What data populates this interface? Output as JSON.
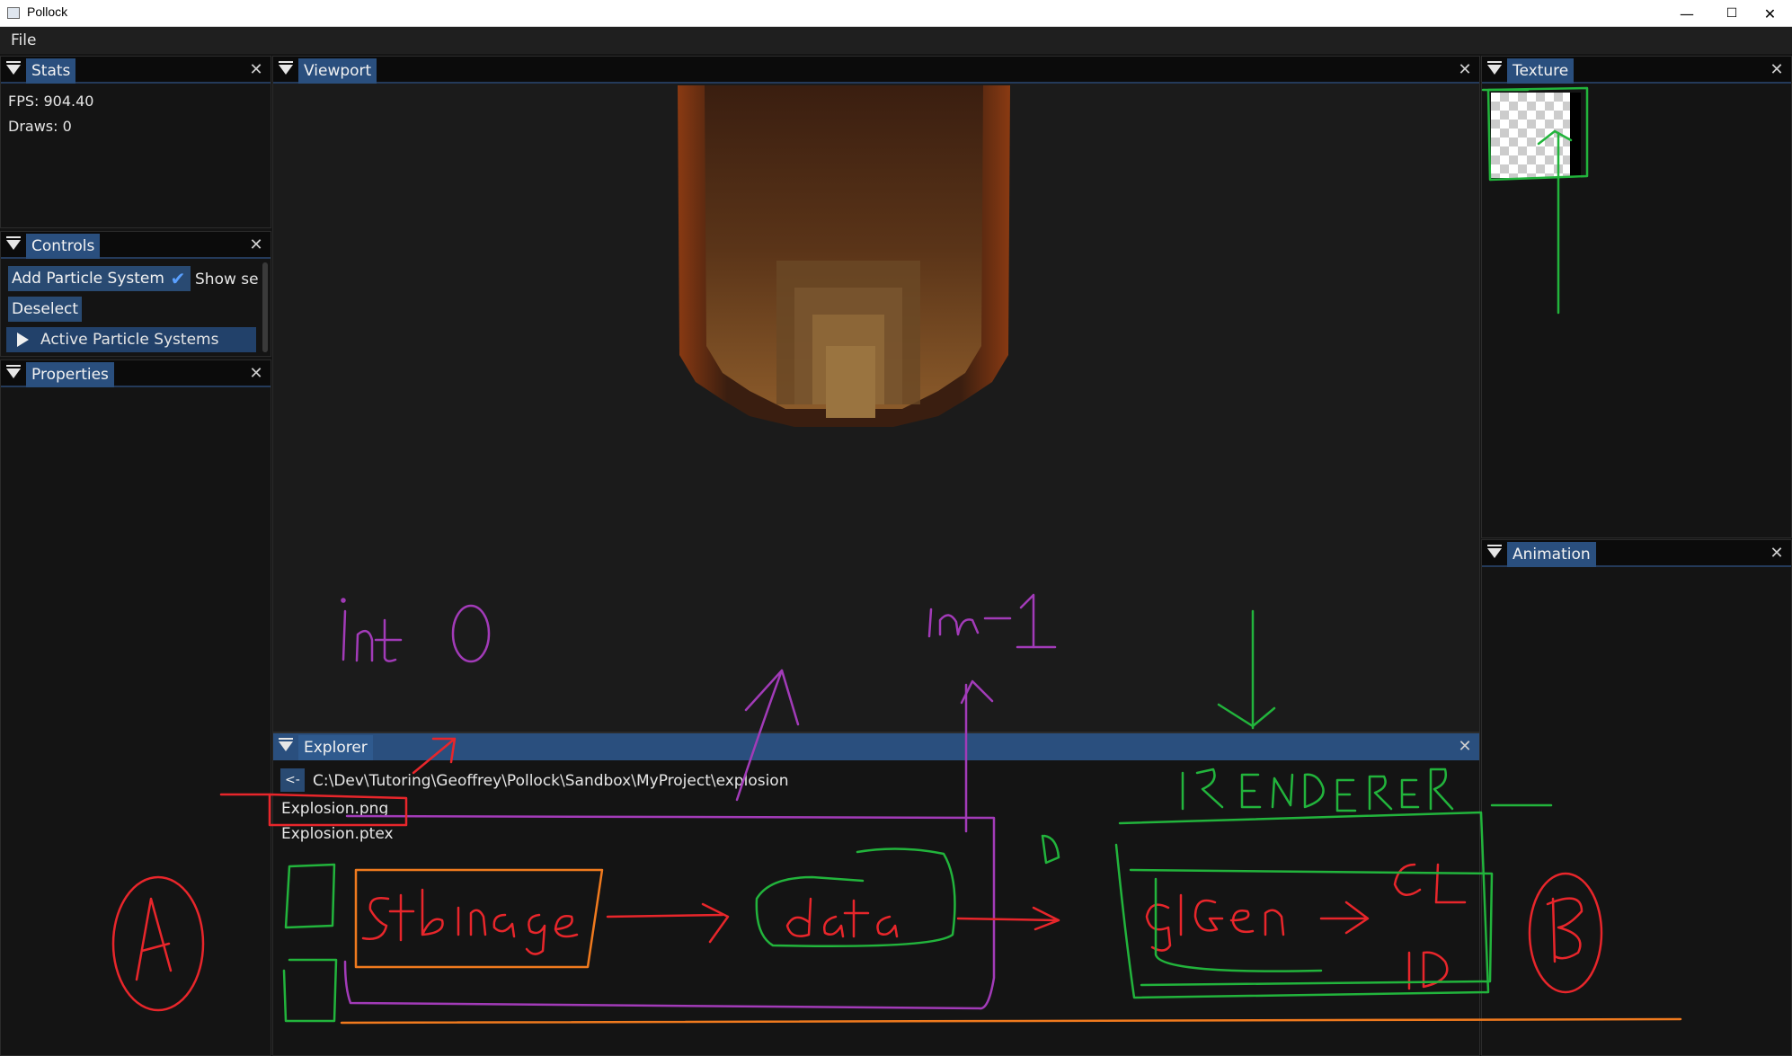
{
  "window": {
    "title": "Pollock"
  },
  "window_controls": {
    "minimize": "—",
    "maximize": "☐",
    "close": "✕"
  },
  "menu": {
    "file": "File"
  },
  "panels": {
    "stats": {
      "tab": "Stats",
      "fps": "FPS: 904.40",
      "draws": "Draws: 0"
    },
    "controls": {
      "tab": "Controls",
      "add_particle_system": "Add Particle System",
      "show_label": "Show se",
      "show_checked": true,
      "deselect": "Deselect",
      "active_particle_systems": "Active Particle Systems"
    },
    "properties": {
      "tab": "Properties"
    },
    "viewport": {
      "tab": "Viewport"
    },
    "texture": {
      "tab": "Texture"
    },
    "animation": {
      "tab": "Animation"
    },
    "explorer": {
      "tab": "Explorer",
      "back_button": "<-",
      "path": "C:\\Dev\\Tutoring\\Geoffrey\\Pollock\\Sandbox\\MyProject\\explosion",
      "files": [
        "Explosion.png",
        "Explosion.ptex"
      ]
    }
  },
  "icons": {
    "panel_menu": "triangle-down-icon",
    "close": "close-icon",
    "expand": "play-triangle-icon",
    "checkbox": "checkmark-icon",
    "app": "app-icon"
  },
  "colors": {
    "accent": "#2a4f7e",
    "panel_bg": "#141414",
    "annotation_red": "#e8262b",
    "annotation_green": "#22b43c",
    "annotation_purple": "#a23bb8",
    "annotation_orange": "#f07a1e"
  }
}
